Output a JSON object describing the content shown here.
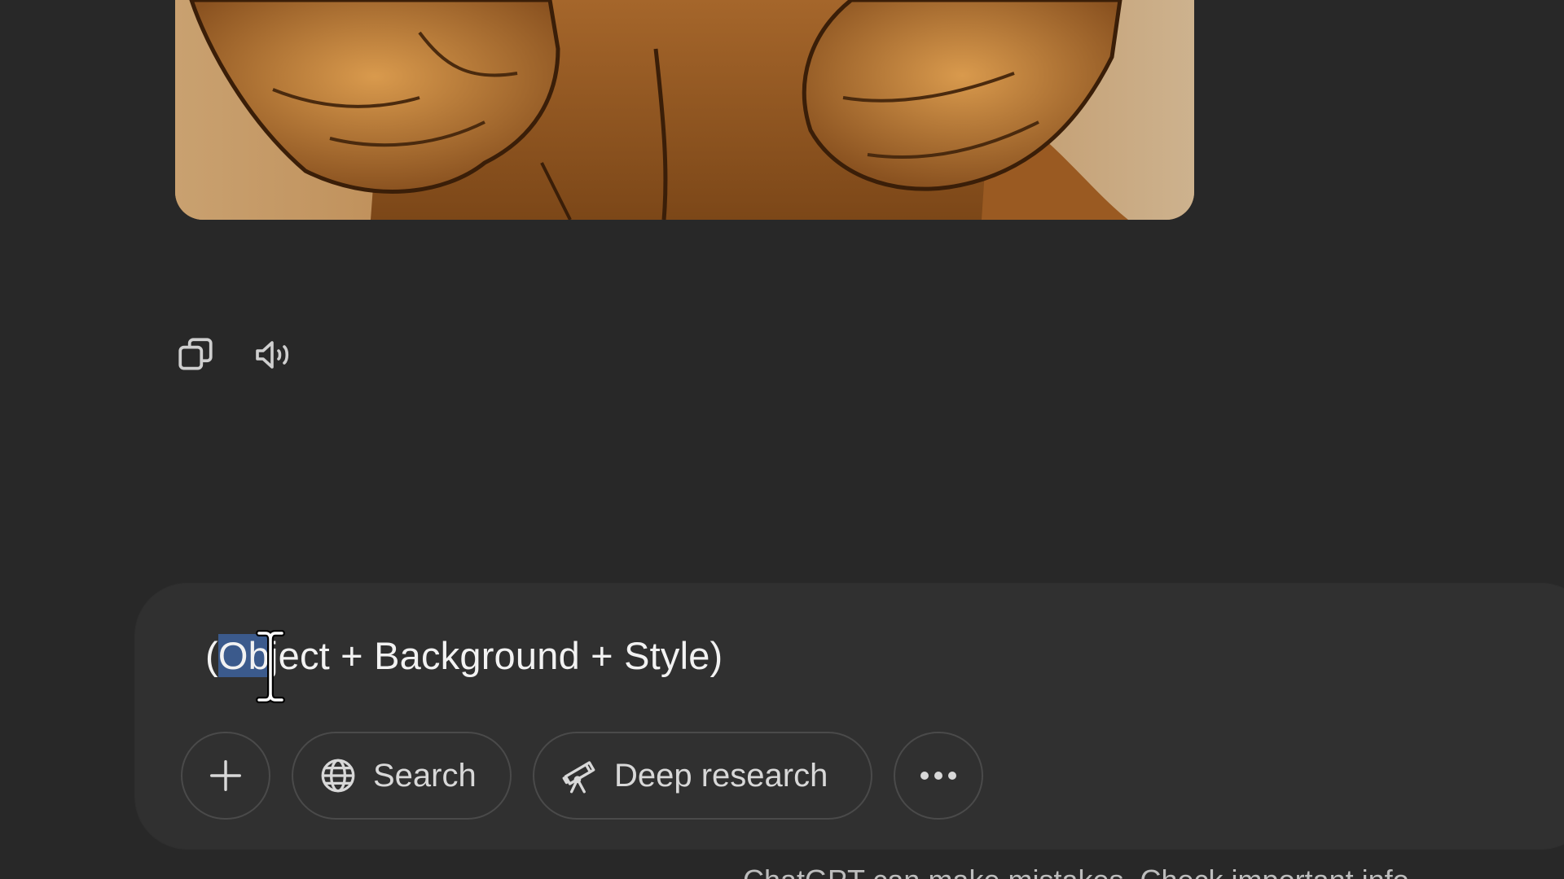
{
  "message": {
    "actions": [
      {
        "name": "copy",
        "icon": "copy-icon"
      },
      {
        "name": "read-aloud",
        "icon": "speaker-icon"
      }
    ]
  },
  "composer": {
    "text_prefix": "(",
    "text_selected": "Ob",
    "text_rest": "ject + Background + Style)",
    "selection_color": "#3b5a8c"
  },
  "tools": {
    "add_icon": "plus-icon",
    "search_label": "Search",
    "search_icon": "globe-icon",
    "deep_research_label": "Deep research",
    "deep_research_icon": "telescope-icon",
    "more_icon": "ellipsis-icon"
  },
  "footer": {
    "note": "ChatGPT can make mistakes. Check important info."
  },
  "colors": {
    "background": "#282828",
    "composer": "#303030",
    "pill_border": "#4a4a4a",
    "text": "#f2f2f2"
  }
}
